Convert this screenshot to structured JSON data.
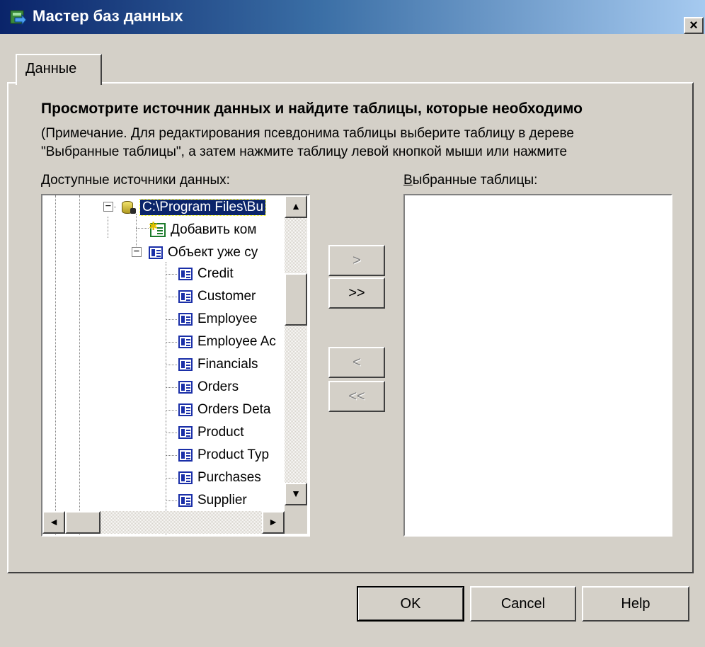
{
  "window": {
    "title": "Мастер баз данных",
    "close_glyph": "×"
  },
  "tab": {
    "label": "Данные"
  },
  "heading": "Просмотрите источник данных и найдите таблицы, которые необходимо",
  "note_line1": "(Примечание. Для редактирования псевдонима таблицы выберите таблицу в дереве",
  "note_line2": "\"Выбранные таблицы\", а затем нажмите таблицу левой кнопкой мыши или нажмите",
  "labels": {
    "available_first": "Д",
    "available_rest": "оступные источники данных:",
    "selected_first": "В",
    "selected_rest": "ыбранные таблицы:"
  },
  "tree": {
    "root": {
      "label": "C:\\Program Files\\Bu",
      "icon": "database-icon",
      "expander": "−"
    },
    "add_connection": {
      "label": "Добавить ком",
      "icon": "add-connection-icon"
    },
    "existing": {
      "label": "Объект уже су",
      "icon": "table-icon",
      "expander": "−"
    },
    "tables": [
      "Credit",
      "Customer",
      "Employee",
      "Employee Aс",
      "Financials",
      "Orders",
      "Orders Deta",
      "Product",
      "Product Typ",
      "Purchases",
      "Supplier"
    ]
  },
  "transfer": {
    "add_one": ">",
    "add_all": ">>",
    "remove_one": "<",
    "remove_all": "<<"
  },
  "buttons": {
    "ok": "OK",
    "cancel": "Cancel",
    "help": "Help"
  },
  "scroll_glyphs": {
    "up": "▲",
    "down": "▼",
    "left": "◄",
    "right": "►"
  }
}
